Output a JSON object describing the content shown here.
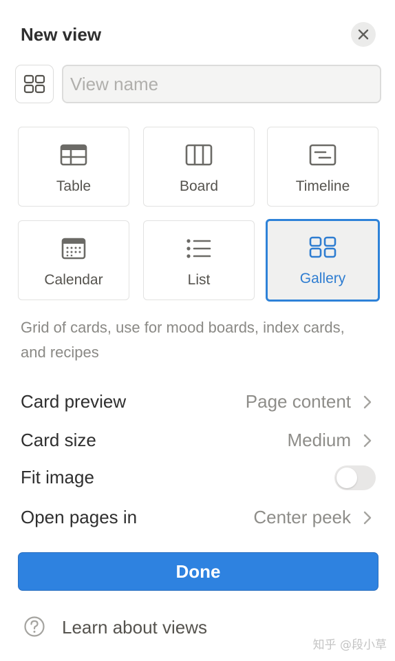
{
  "header": {
    "title": "New view",
    "close_icon": "close-icon"
  },
  "view_name": {
    "icon": "gallery-grid-icon",
    "placeholder": "View name",
    "value": ""
  },
  "layouts": [
    {
      "label": "Table",
      "icon": "table-icon",
      "selected": false
    },
    {
      "label": "Board",
      "icon": "board-icon",
      "selected": false
    },
    {
      "label": "Timeline",
      "icon": "timeline-icon",
      "selected": false
    },
    {
      "label": "Calendar",
      "icon": "calendar-icon",
      "selected": false
    },
    {
      "label": "List",
      "icon": "list-icon",
      "selected": false
    },
    {
      "label": "Gallery",
      "icon": "gallery-icon",
      "selected": true
    }
  ],
  "description": "Grid of cards, use for mood boards, index cards, and recipes",
  "settings": {
    "card_preview": {
      "label": "Card preview",
      "value": "Page content"
    },
    "card_size": {
      "label": "Card size",
      "value": "Medium"
    },
    "fit_image": {
      "label": "Fit image",
      "enabled": false
    },
    "open_pages_in": {
      "label": "Open pages in",
      "value": "Center peek"
    }
  },
  "done_label": "Done",
  "learn_label": "Learn about views",
  "watermark": "知乎 @段小草",
  "colors": {
    "accent": "#2e82e0",
    "selected_text": "#2e7dd1",
    "muted": "#8e8d89"
  }
}
